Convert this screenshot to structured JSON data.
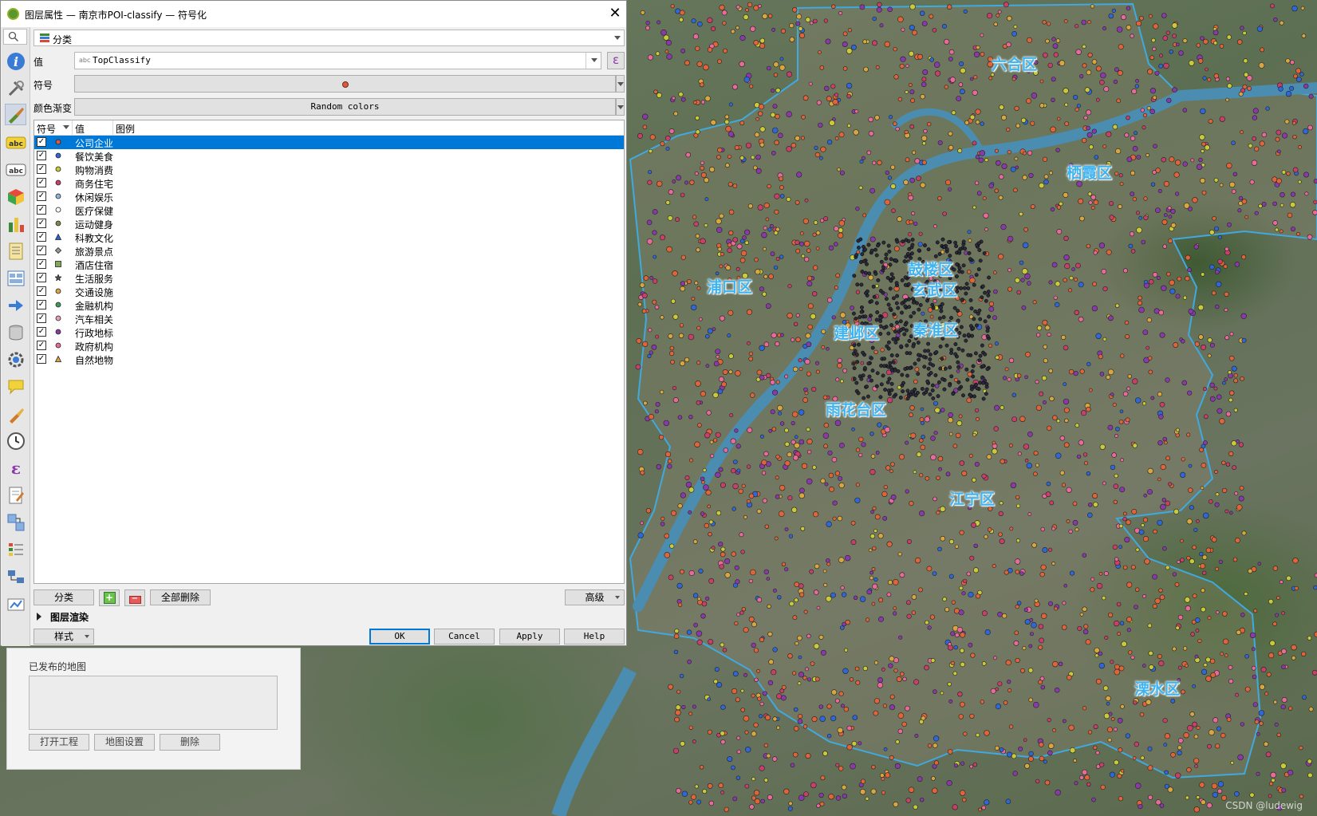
{
  "dialog": {
    "title": "图层属性 — 南京市POI-classify — 符号化",
    "close_glyph": "✕",
    "renderer": "分类",
    "value_label": "值",
    "value_field": "TopClassify",
    "value_field_type": "abc",
    "expression_glyph": "ε",
    "symbol_label": "符号",
    "ramp_label": "颜色渐变",
    "ramp_value": "Random colors",
    "columns": [
      "符号",
      "值",
      "图例"
    ],
    "classes": [
      {
        "value": "公司企业",
        "color": "#e05a3a",
        "shape": "circle",
        "selected": true
      },
      {
        "value": "餐饮美食",
        "color": "#2f67d8",
        "shape": "circle"
      },
      {
        "value": "购物消费",
        "color": "#c9c93a",
        "shape": "circle"
      },
      {
        "value": "商务住宅",
        "color": "#c8406a",
        "shape": "circle"
      },
      {
        "value": "休闲娱乐",
        "color": "#8fb4d8",
        "shape": "circle"
      },
      {
        "value": "医疗保健",
        "color": "#ffffff",
        "shape": "circle"
      },
      {
        "value": "运动健身",
        "color": "#7a8c4a",
        "shape": "circle"
      },
      {
        "value": "科教文化",
        "color": "#2f5fd0",
        "shape": "triangle"
      },
      {
        "value": "旅游景点",
        "color": "#9a9a9a",
        "shape": "diamond"
      },
      {
        "value": "酒店住宿",
        "color": "#7fa85a",
        "shape": "square"
      },
      {
        "value": "生活服务",
        "color": "#555555",
        "shape": "star"
      },
      {
        "value": "交通设施",
        "color": "#d8a640",
        "shape": "circle"
      },
      {
        "value": "金融机构",
        "color": "#3f9a5a",
        "shape": "circle"
      },
      {
        "value": "汽车相关",
        "color": "#e8a0b0",
        "shape": "circle"
      },
      {
        "value": "行政地标",
        "color": "#8a3aa8",
        "shape": "circle"
      },
      {
        "value": "政府机构",
        "color": "#e86a9a",
        "shape": "circle"
      },
      {
        "value": "自然地物",
        "color": "#e0a040",
        "shape": "triangle"
      }
    ],
    "classify_button": "分类",
    "add_glyph": "+",
    "remove_glyph": "−",
    "delete_all_button": "全部删除",
    "advanced_button": "高级",
    "layer_rendering": "图层渲染",
    "style_button": "样式",
    "ok_button": "OK",
    "cancel_button": "Cancel",
    "apply_button": "Apply",
    "help_button": "Help",
    "check_glyph": "✓",
    "sidebar_icons": [
      "search-icon",
      "information-icon",
      "source-icon",
      "symbology-icon",
      "labels-icon",
      "masks-icon",
      "3d-view-icon",
      "diagrams-icon",
      "fields-icon",
      "attributes-form-icon",
      "joins-icon",
      "auxiliary-storage-icon",
      "actions-icon",
      "display-icon",
      "rendering-icon",
      "temporal-icon",
      "variables-icon",
      "metadata-icon",
      "dependencies-icon",
      "legend-icon",
      "qgis-server-icon",
      "digitizing-icon"
    ]
  },
  "under_panel": {
    "title": "已发布的地图",
    "open_project": "打开工程",
    "map_settings": "地图设置",
    "delete": "删除"
  },
  "map": {
    "districts": [
      "六合区",
      "栖霞区",
      "鼓楼区",
      "玄武区",
      "浦口区",
      "建邺区",
      "秦淮区",
      "雨花台区",
      "江宁区",
      "溧水区"
    ],
    "river_color": "#4a8db0",
    "boundary_color": "#3fa9e0",
    "watermark": "CSDN @ludewig"
  }
}
